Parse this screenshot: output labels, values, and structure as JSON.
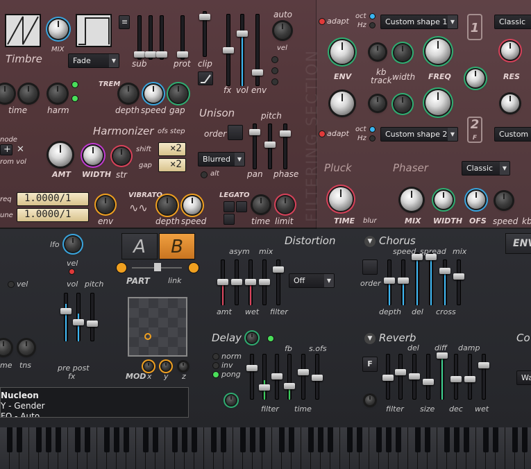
{
  "timbre": {
    "title": "Timbre",
    "mix_label": "MIX",
    "fade_select": "Fade",
    "sub": "sub",
    "prot": "prot",
    "clip": "clip",
    "fx": "fx",
    "vol": "vol",
    "env": "env",
    "auto": "auto",
    "vel": "vel"
  },
  "mod": {
    "time": "time",
    "harm": "harm",
    "trem": "TREM",
    "depth": "depth",
    "speed": "speed",
    "gap": "gap"
  },
  "harmonizer": {
    "title": "Harmonizer",
    "ofs_step": "ofs step",
    "shift": "shift",
    "gap": "gap",
    "x2a": "×2",
    "x2b": "×2",
    "amt": "AMT",
    "width": "WIDTH",
    "str": "str",
    "node": "node",
    "from_vol": "rom vol"
  },
  "unison": {
    "title": "Unison",
    "order": "order",
    "pitch": "pitch",
    "pan": "pan",
    "phase": "phase",
    "mode": "Blurred",
    "alt": "alt"
  },
  "vibrato": {
    "title": "VIBRATO",
    "depth": "depth",
    "speed": "speed",
    "env": "env",
    "freq_val": "1.0000/1",
    "tune_val": "1.0000/1",
    "freq": "req",
    "tune": "une"
  },
  "legato": {
    "title": "LEGATO",
    "time": "time",
    "limit": "limit"
  },
  "filter": {
    "section": "FILTERING SECTION",
    "adapt1": "adapt",
    "adapt2": "adapt",
    "oct": "oct",
    "hz": "Hz",
    "shape1": "Custom shape 1",
    "shape2": "Custom shape 2",
    "classic1": "Classic",
    "classic2": "Custom sh",
    "env": "ENV",
    "kb_track": "kb\ntrack",
    "width": "width",
    "freq": "FREQ",
    "res": "RES",
    "f1": "1",
    "f2": "2",
    "fl": "F",
    "pluck": "Pluck",
    "time": "TIME",
    "blur": "blur",
    "phaser": "Phaser",
    "classic3": "Classic",
    "mix": "MIX",
    "pwidth": "WIDTH",
    "ofs": "OFS",
    "speed": "speed",
    "kb": "kb"
  },
  "ab": {
    "a": "A",
    "b": "B",
    "part": "PART",
    "link": "link"
  },
  "left": {
    "lfo": "lfo",
    "vel": "vel",
    "vel2": "vel",
    "vol": "vol",
    "pitch": "pitch",
    "me": "me",
    "tns": "tns",
    "pre": "pre",
    "post": "post",
    "fx": "fx"
  },
  "xy": {
    "mod": "MOD",
    "x": "x",
    "y": "y",
    "z": "z"
  },
  "preset": {
    "line1": "Nucleon",
    "line2": "Y - Gender",
    "line3": "FO - Auto"
  },
  "distortion": {
    "title": "Distortion",
    "asym": "asym",
    "mix": "mix",
    "amt": "amt",
    "wet": "wet",
    "filter": "filter",
    "mode": "Off"
  },
  "chorus": {
    "title": "Chorus",
    "speed": "speed",
    "spread": "spread",
    "mix": "mix",
    "order": "order",
    "depth": "depth",
    "del": "del",
    "cross": "cross"
  },
  "delay": {
    "title": "Delay",
    "fb": "fb",
    "sofs": "s.ofs",
    "norm": "norm",
    "inv": "inv",
    "pong": "pong",
    "filter": "filter",
    "time": "time"
  },
  "reverb": {
    "title": "Reverb",
    "del": "del",
    "diff": "diff",
    "damp": "damp",
    "filter": "filter",
    "size": "size",
    "dec": "dec",
    "wet": "wet",
    "f": "F"
  },
  "right": {
    "env_tab": "ENV",
    "co": "Co",
    "wa": "Wa"
  }
}
